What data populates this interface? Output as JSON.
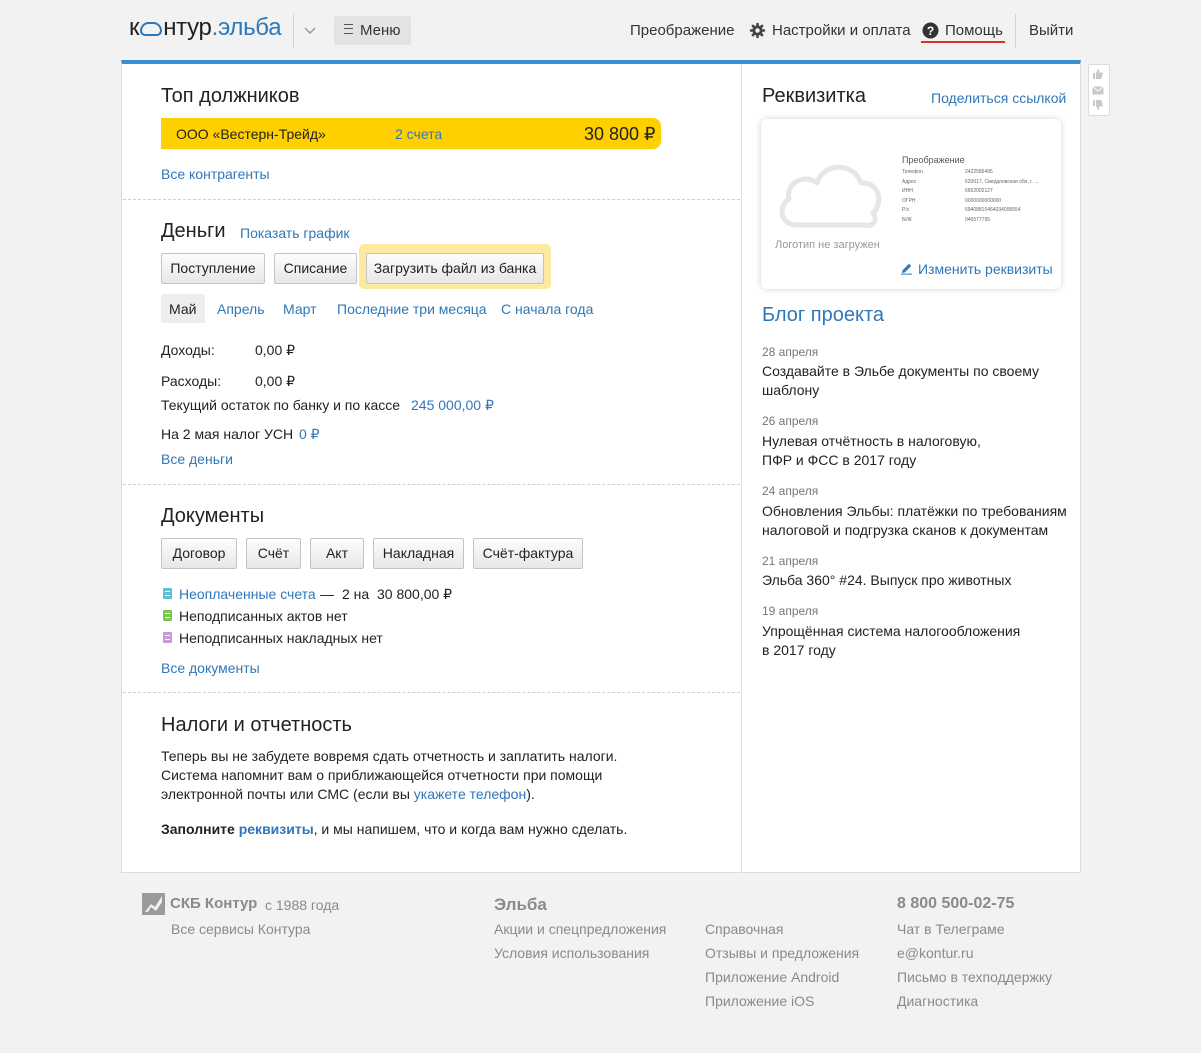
{
  "header": {
    "logo_left": "к",
    "logo_mid": "нтур",
    "logo_dot": ".эльба",
    "menu_label": "Меню",
    "nav_transform": "Преображение",
    "nav_settings": "Настройки и оплата",
    "nav_help": "Помощь",
    "nav_exit": "Выйти"
  },
  "top_debtors": {
    "title": "Топ должников",
    "company": "ООО «Вестерн-Трейд»",
    "invoices": "2 счета",
    "amount": "30 800 ₽",
    "all_link": "Все контрагенты"
  },
  "money": {
    "title": "Деньги",
    "show_chart": "Показать график",
    "buttons": [
      "Поступление",
      "Списание",
      "Загрузить файл из банка"
    ],
    "periods": [
      "Май",
      "Апрель",
      "Март",
      "Последние три месяца",
      "С начала года"
    ],
    "income_label": "Доходы:",
    "income_value": "0,00 ₽",
    "expense_label": "Расходы:",
    "expense_value": "0,00 ₽",
    "balance_label": "Текущий остаток по банку и по кассе",
    "balance_value": "245 000,00 ₽",
    "tax_label": "На 2 мая налог УСН",
    "tax_value": "0 ₽",
    "all_link": "Все деньги"
  },
  "documents": {
    "title": "Документы",
    "buttons": [
      "Договор",
      "Счёт",
      "Акт",
      "Накладная",
      "Счёт-фактура"
    ],
    "unpaid_link": "Неоплаченные счета",
    "unpaid_dash": "—",
    "unpaid_count": "2 на",
    "unpaid_amount": "30 800,00 ₽",
    "unsigned_acts": "Неподписанных актов нет",
    "unsigned_waybills": "Неподписанных накладных нет",
    "all_link": "Все документы",
    "icon_colors": [
      "#5bc0d8",
      "#7cc84e",
      "#c99ad6"
    ]
  },
  "taxes": {
    "title": "Налоги и отчетность",
    "line1": "Теперь вы не забудете вовремя сдать отчетность и заплатить налоги.",
    "line2": "Система напомнит вам о приближающейся отчетности при помощи",
    "line3_pre": "электронной почты или СМС (если вы",
    "line3_link": "укажете телефон",
    "line3_post": ").",
    "cta_bold": "Заполните",
    "cta_link": "реквизиты",
    "cta_rest": ", и мы напишем, что и когда вам нужно сделать."
  },
  "requisites": {
    "title": "Реквизитка",
    "share_link": "Поделиться ссылкой",
    "logo_missing": "Логотип не загружен",
    "company": "Преображение",
    "fields": [
      {
        "k": "Телефон",
        "v": "2422586495"
      },
      {
        "k": "Адрес",
        "v": "620017, Свердловская обл, г. ..."
      },
      {
        "k": "ИНН",
        "v": "6662002127"
      },
      {
        "k": "ОГРН",
        "v": "0000000000000"
      },
      {
        "k": "Р/с",
        "v": "69408810464034095554"
      },
      {
        "k": "БИК",
        "v": "046577795"
      }
    ],
    "edit_link": "Изменить реквизиты"
  },
  "blog": {
    "title": "Блог проекта",
    "posts": [
      {
        "date": "28 апреля",
        "l1": "Создавайте в Эльбе документы по своему",
        "l2": "шаблону"
      },
      {
        "date": "26 апреля",
        "l1": "Нулевая отчётность в налоговую,",
        "l2": "ПФР и ФСС в 2017 году"
      },
      {
        "date": "24 апреля",
        "l1": "Обновления Эльбы: платёжки по требованиям",
        "l2": "налоговой и подгрузка сканов к документам"
      },
      {
        "date": "21 апреля",
        "l1": "Эльба 360° #24. Выпуск про животных",
        "l2": ""
      },
      {
        "date": "19 апреля",
        "l1": "Упрощённая система налогообложения",
        "l2": "в 2017 году"
      }
    ]
  },
  "footer": {
    "brand": "СКБ Контур",
    "since": "с 1988 года",
    "all_services": "Все сервисы Контура",
    "elba": "Эльба",
    "col1": [
      "Акции и спецпредложения",
      "Условия использования"
    ],
    "col2": [
      "Справочная",
      "Отзывы и предложения",
      "Приложение Android",
      "Приложение iOS"
    ],
    "phone": "8 800 500-02-75",
    "col3": [
      "Чат в Телеграме",
      "e@kontur.ru",
      "Письмо в техподдержку",
      "Диагностика"
    ]
  },
  "colors": {
    "accent": "#2f77b8",
    "debt_bar": "#ffd000",
    "top_border": "#3a8fd0",
    "help_underline": "#d9342b"
  }
}
